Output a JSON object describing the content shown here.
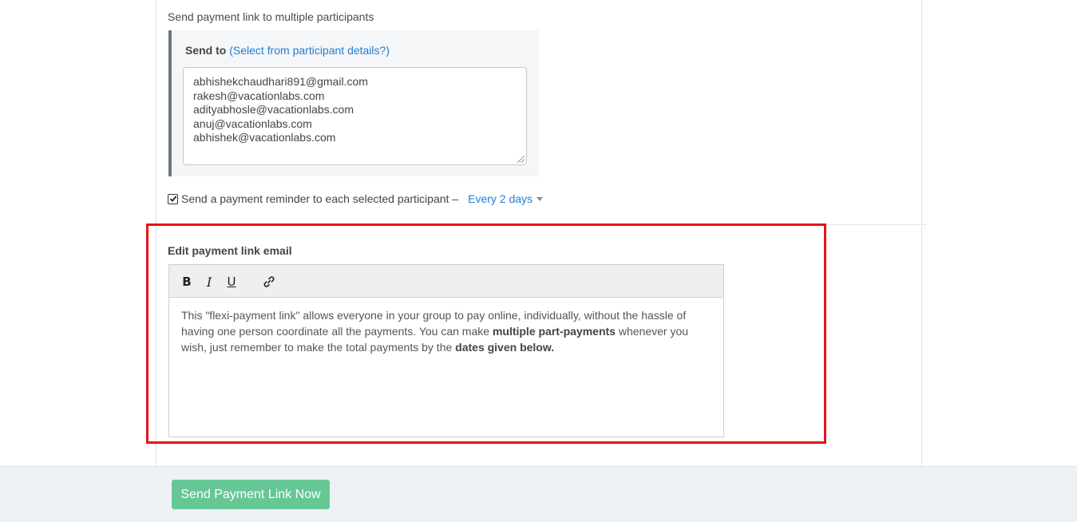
{
  "multi_send": {
    "section_title": "Send payment link to multiple participants",
    "send_to_label": "Send to",
    "select_link": "(Select from participant details?)",
    "emails": [
      "abhishekchaudhari891@gmail.com",
      "rakesh@vacationlabs.com",
      "adityabhosle@vacationlabs.com",
      "anuj@vacationlabs.com",
      "abhishek@vacationlabs.com"
    ]
  },
  "reminder": {
    "checked": true,
    "label": "Send a payment reminder to each selected participant –",
    "frequency": "Every 2 days"
  },
  "email_editor": {
    "title": "Edit payment link email",
    "toolbar": {
      "bold": "B",
      "italic": "I",
      "underline": "U"
    },
    "body_part1": "This \"flexi-payment link\" allows everyone in your group to pay online, individually, without the hassle of having one person coordinate all the payments. You can make ",
    "body_bold1": "multiple part-payments",
    "body_part2": " whenever you wish, just remember to make the total payments by the ",
    "body_bold2": "dates given below."
  },
  "footer": {
    "send_button": "Send Payment Link Now"
  },
  "colors": {
    "link": "#1e7ed8",
    "highlight_border": "#e4141c",
    "send_button_bg": "#66c795"
  },
  "icons": [
    "check-icon",
    "caret-down-icon",
    "link-icon"
  ]
}
